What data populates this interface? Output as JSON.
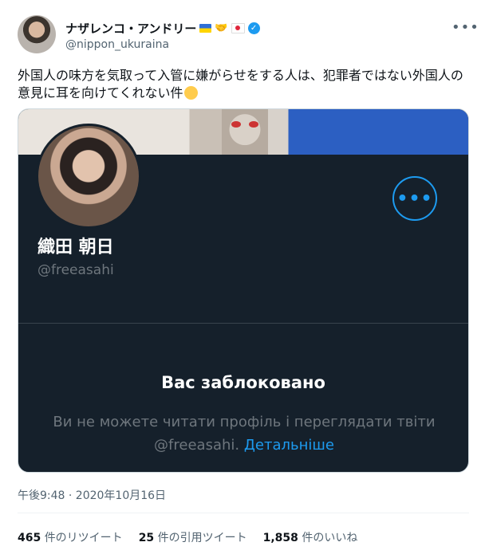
{
  "author": {
    "display_name": "ナザレンコ・アンドリー",
    "handle": "@nippon_ukuraina",
    "verified_icon": "verified-badge-icon"
  },
  "tweet": {
    "text": "外国人の味方を気取って入管に嫌がらせをする人は、犯罪者ではない外国人の意見に耳を向けてくれない件",
    "emoji": "face-with-rolling-eyes",
    "timestamp": "午後9:48 · 2020年10月16日"
  },
  "card": {
    "profile_name": "織田 朝日",
    "profile_handle": "@freeasahi",
    "blocked_title": "Вас заблоковано",
    "blocked_desc": "Ви не можете читати профіль і переглядати твіти @freeasahi.",
    "blocked_link": "Детальніше",
    "more_icon": "more-dots-icon"
  },
  "stats": [
    {
      "count": "465",
      "label": "件のリツイート"
    },
    {
      "count": "25",
      "label": "件の引用ツイート"
    },
    {
      "count": "1,858",
      "label": "件のいいね"
    }
  ],
  "colors": {
    "accent": "#1d9bf0",
    "card_bg": "#15202b",
    "muted": "#536471"
  }
}
